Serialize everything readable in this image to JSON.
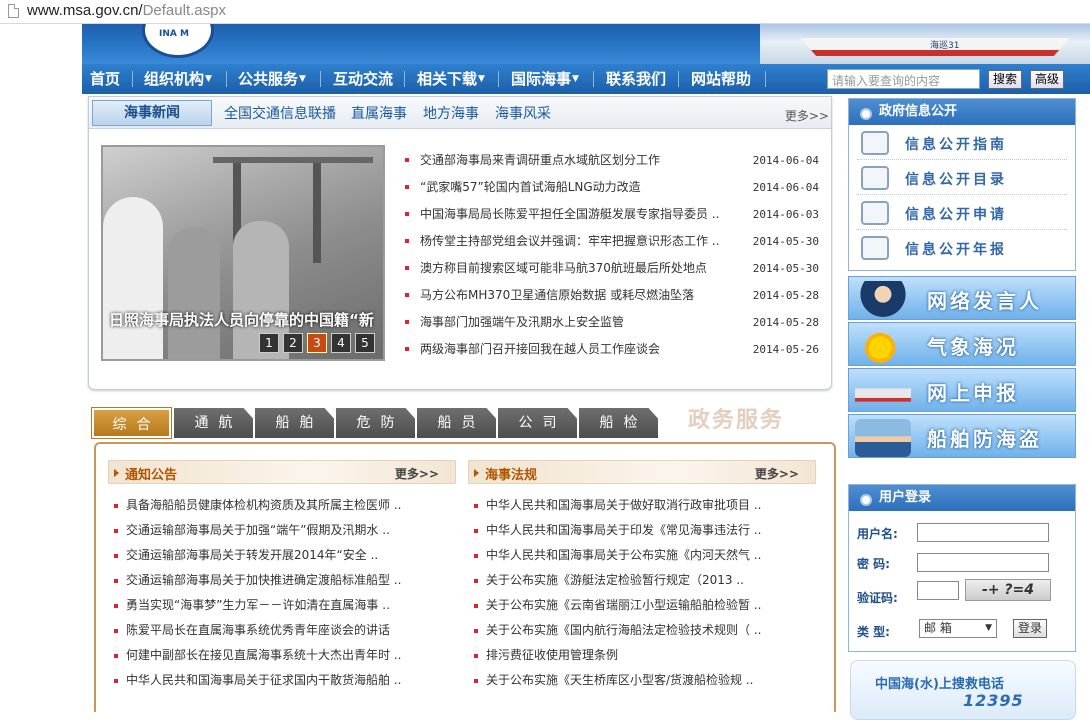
{
  "address": {
    "host": "www.msa.gov.cn/",
    "path": "Default.aspx"
  },
  "banner": {
    "logo_text": "INA M",
    "ship_text": "海巡31"
  },
  "nav": {
    "items": [
      {
        "label": "首页",
        "dropdown": false
      },
      {
        "label": "组织机构",
        "dropdown": true
      },
      {
        "label": "公共服务",
        "dropdown": true
      },
      {
        "label": "互动交流",
        "dropdown": false
      },
      {
        "label": "相关下载",
        "dropdown": true
      },
      {
        "label": "国际海事",
        "dropdown": true
      },
      {
        "label": "联系我们",
        "dropdown": false
      },
      {
        "label": "网站帮助",
        "dropdown": false
      }
    ],
    "caret": "▼",
    "search_placeholder": "请输入要查询的内容",
    "search_button": "搜索",
    "advanced_button": "高级"
  },
  "news": {
    "active_tab": "海事新闻",
    "tabs": [
      "全国交通信息联播",
      "直属海事",
      "地方海事",
      "海事风采"
    ],
    "more": "更多>>",
    "photo_caption": "日照海事局执法人员向停靠的中国籍“新",
    "pager": [
      "1",
      "2",
      "3",
      "4",
      "5"
    ],
    "pager_active": 2,
    "items": [
      {
        "title": "交通部海事局来青调研重点水域航区划分工作",
        "date": "2014-06-04"
      },
      {
        "title": "“武家嘴57”轮国内首试海船LNG动力改造",
        "date": "2014-06-04"
      },
      {
        "title": "中国海事局局长陈爱平担任全国游艇发展专家指导委员 ..",
        "date": "2014-06-03"
      },
      {
        "title": "杨传堂主持部党组会议并强调：牢牢把握意识形态工作 ..",
        "date": "2014-05-30"
      },
      {
        "title": "澳方称目前搜索区域可能非马航370航班最后所处地点",
        "date": "2014-05-30"
      },
      {
        "title": "马方公布MH370卫星通信原始数据 或耗尽燃油坠落",
        "date": "2014-05-28"
      },
      {
        "title": "海事部门加强端午及汛期水上安全监管",
        "date": "2014-05-28"
      },
      {
        "title": "两级海事部门召开接回我在越人员工作座谈会",
        "date": "2014-05-26"
      }
    ]
  },
  "services": {
    "tabs": [
      "综合",
      "通航",
      "船舶",
      "危防",
      "船员",
      "公司",
      "船检"
    ],
    "active": 0,
    "watermark": "政务服务"
  },
  "notices": {
    "title": "通知公告",
    "more": "更多>>",
    "items": [
      "具备海船船员健康体检机构资质及其所属主检医师 ..",
      "交通运输部海事局关于加强“端午”假期及汛期水 ..",
      "交通运输部海事局关于转发开展2014年“安全 ..",
      "交通运输部海事局关于加快推进确定渡船标准船型 ..",
      "勇当实现“海事梦”生力军－－许如清在直属海事 ..",
      "陈爱平局长在直属海事系统优秀青年座谈会的讲话",
      "何建中副部长在接见直属海事系统十大杰出青年时 ..",
      "中华人民共和国海事局关于征求国内干散货海船舶 .."
    ]
  },
  "regulations": {
    "title": "海事法规",
    "more": "更多>>",
    "items": [
      "中华人民共和国海事局关于做好取消行政审批项目 ..",
      "中华人民共和国海事局关于印发《常见海事违法行 ..",
      "中华人民共和国海事局关于公布实施《内河天然气 ..",
      "关于公布实施《游艇法定检验暂行规定（2013 ..",
      "关于公布实施《云南省瑞丽江小型运输船舶检验暂 ..",
      "关于公布实施《国内航行海船法定检验技术规则（ ..",
      "排污费征收使用管理条例",
      "关于公布实施《天生桥库区小型客/货渡船检验规 .."
    ]
  },
  "gov_info": {
    "title": "政府信息公开",
    "items": [
      "信息公开指南",
      "信息公开目录",
      "信息公开申请",
      "信息公开年报"
    ]
  },
  "banners": [
    "网络发言人",
    "气象海况",
    "网上申报",
    "船舶防海盗"
  ],
  "login": {
    "title": "用户登录",
    "username_label": "用户名:",
    "password_label": "密 码:",
    "captcha_label": "验证码:",
    "captcha_text": "-+ ?=4",
    "type_label": "类 型:",
    "type_value": "邮 箱",
    "login_button": "登录"
  },
  "hotline": {
    "title": "中国海(水)上搜救电话",
    "number": "12395"
  }
}
